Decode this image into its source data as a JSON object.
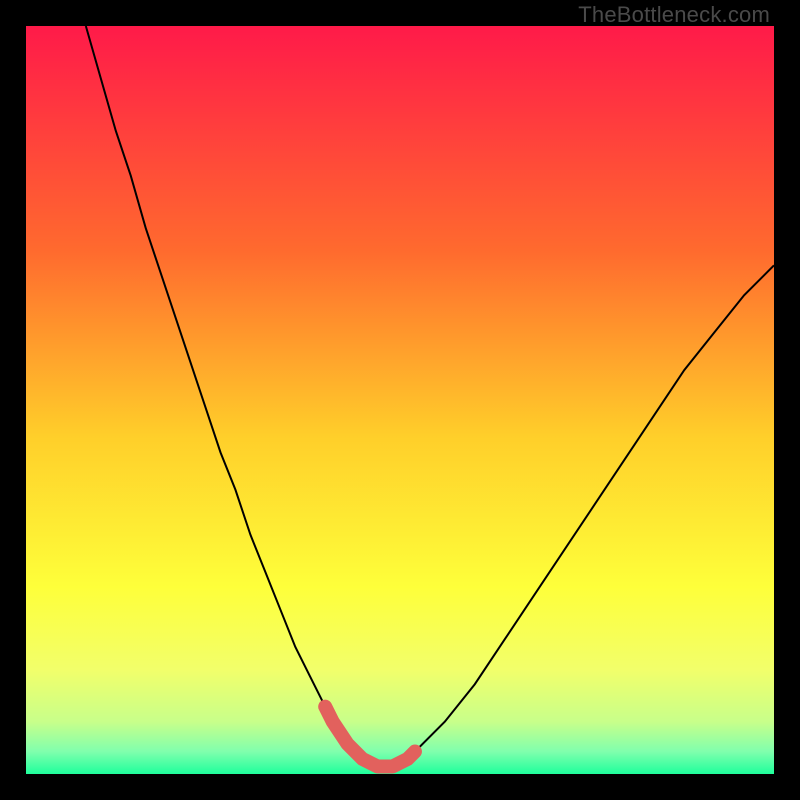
{
  "watermark": "TheBottleneck.com",
  "colors": {
    "black": "#000000",
    "curve": "#000000",
    "highlight": "#e2615d",
    "grad_top": "#ff1a49",
    "grad_mid1": "#ff8a2a",
    "grad_mid2": "#ffe42a",
    "grad_low1": "#eaff6a",
    "grad_low2": "#a4ff9a",
    "grad_bottom": "#2bff99"
  },
  "chart_data": {
    "type": "line",
    "title": "",
    "xlabel": "",
    "ylabel": "",
    "xlim": [
      0,
      100
    ],
    "ylim": [
      0,
      100
    ],
    "series": [
      {
        "name": "bottleneck-curve",
        "x": [
          8,
          10,
          12,
          14,
          16,
          18,
          20,
          22,
          24,
          26,
          28,
          30,
          32,
          34,
          36,
          38,
          40,
          42,
          44,
          46,
          48,
          50,
          52,
          56,
          60,
          64,
          68,
          72,
          76,
          80,
          84,
          88,
          92,
          96,
          100
        ],
        "y": [
          100,
          93,
          86,
          80,
          73,
          67,
          61,
          55,
          49,
          43,
          38,
          32,
          27,
          22,
          17,
          13,
          9,
          5.5,
          3,
          1.5,
          1,
          1.5,
          3,
          7,
          12,
          18,
          24,
          30,
          36,
          42,
          48,
          54,
          59,
          64,
          68
        ]
      },
      {
        "name": "optimal-highlight",
        "x": [
          40,
          41,
          42,
          43,
          44,
          45,
          46,
          47,
          48,
          49,
          50,
          51,
          52
        ],
        "y": [
          9,
          7,
          5.5,
          4,
          3,
          2,
          1.5,
          1,
          1,
          1,
          1.5,
          2,
          3
        ]
      }
    ],
    "annotations": []
  }
}
